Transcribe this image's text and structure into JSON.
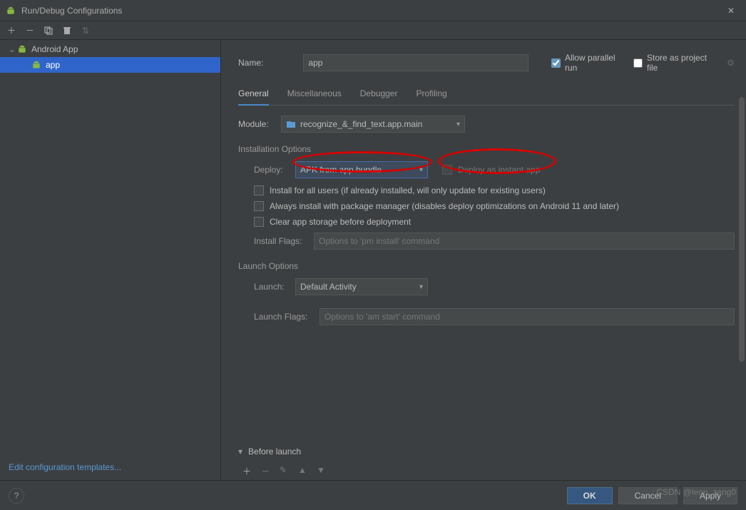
{
  "titlebar": {
    "title": "Run/Debug Configurations"
  },
  "tree": {
    "root": "Android App",
    "child": "app"
  },
  "sidebar": {
    "edit_templates": "Edit configuration templates..."
  },
  "form": {
    "name_label": "Name:",
    "name_value": "app",
    "allow_parallel": "Allow parallel run",
    "store_as_project": "Store as project file"
  },
  "tabs": {
    "general": "General",
    "misc": "Miscellaneous",
    "debugger": "Debugger",
    "profiling": "Profiling"
  },
  "module": {
    "label": "Module:",
    "value": "recognize_&_find_text.app.main"
  },
  "install": {
    "section": "Installation Options",
    "deploy_label": "Deploy:",
    "deploy_value": "APK from app bundle",
    "instant": "Deploy as instant app",
    "all_users": "Install for all users (if already installed, will only update for existing users)",
    "pkg_mgr": "Always install with package manager (disables deploy optimizations on Android 11 and later)",
    "clear": "Clear app storage before deployment",
    "flags_label": "Install Flags:",
    "flags_ph": "Options to 'pm install' command"
  },
  "launch": {
    "section": "Launch Options",
    "label": "Launch:",
    "value": "Default Activity",
    "flags_label": "Launch Flags:",
    "flags_ph": "Options to 'am start' command"
  },
  "before": {
    "title": "Before launch"
  },
  "buttons": {
    "ok": "OK",
    "cancel": "Cancel",
    "apply": "Apply"
  },
  "watermark": "CSDN @leon_zeng0"
}
